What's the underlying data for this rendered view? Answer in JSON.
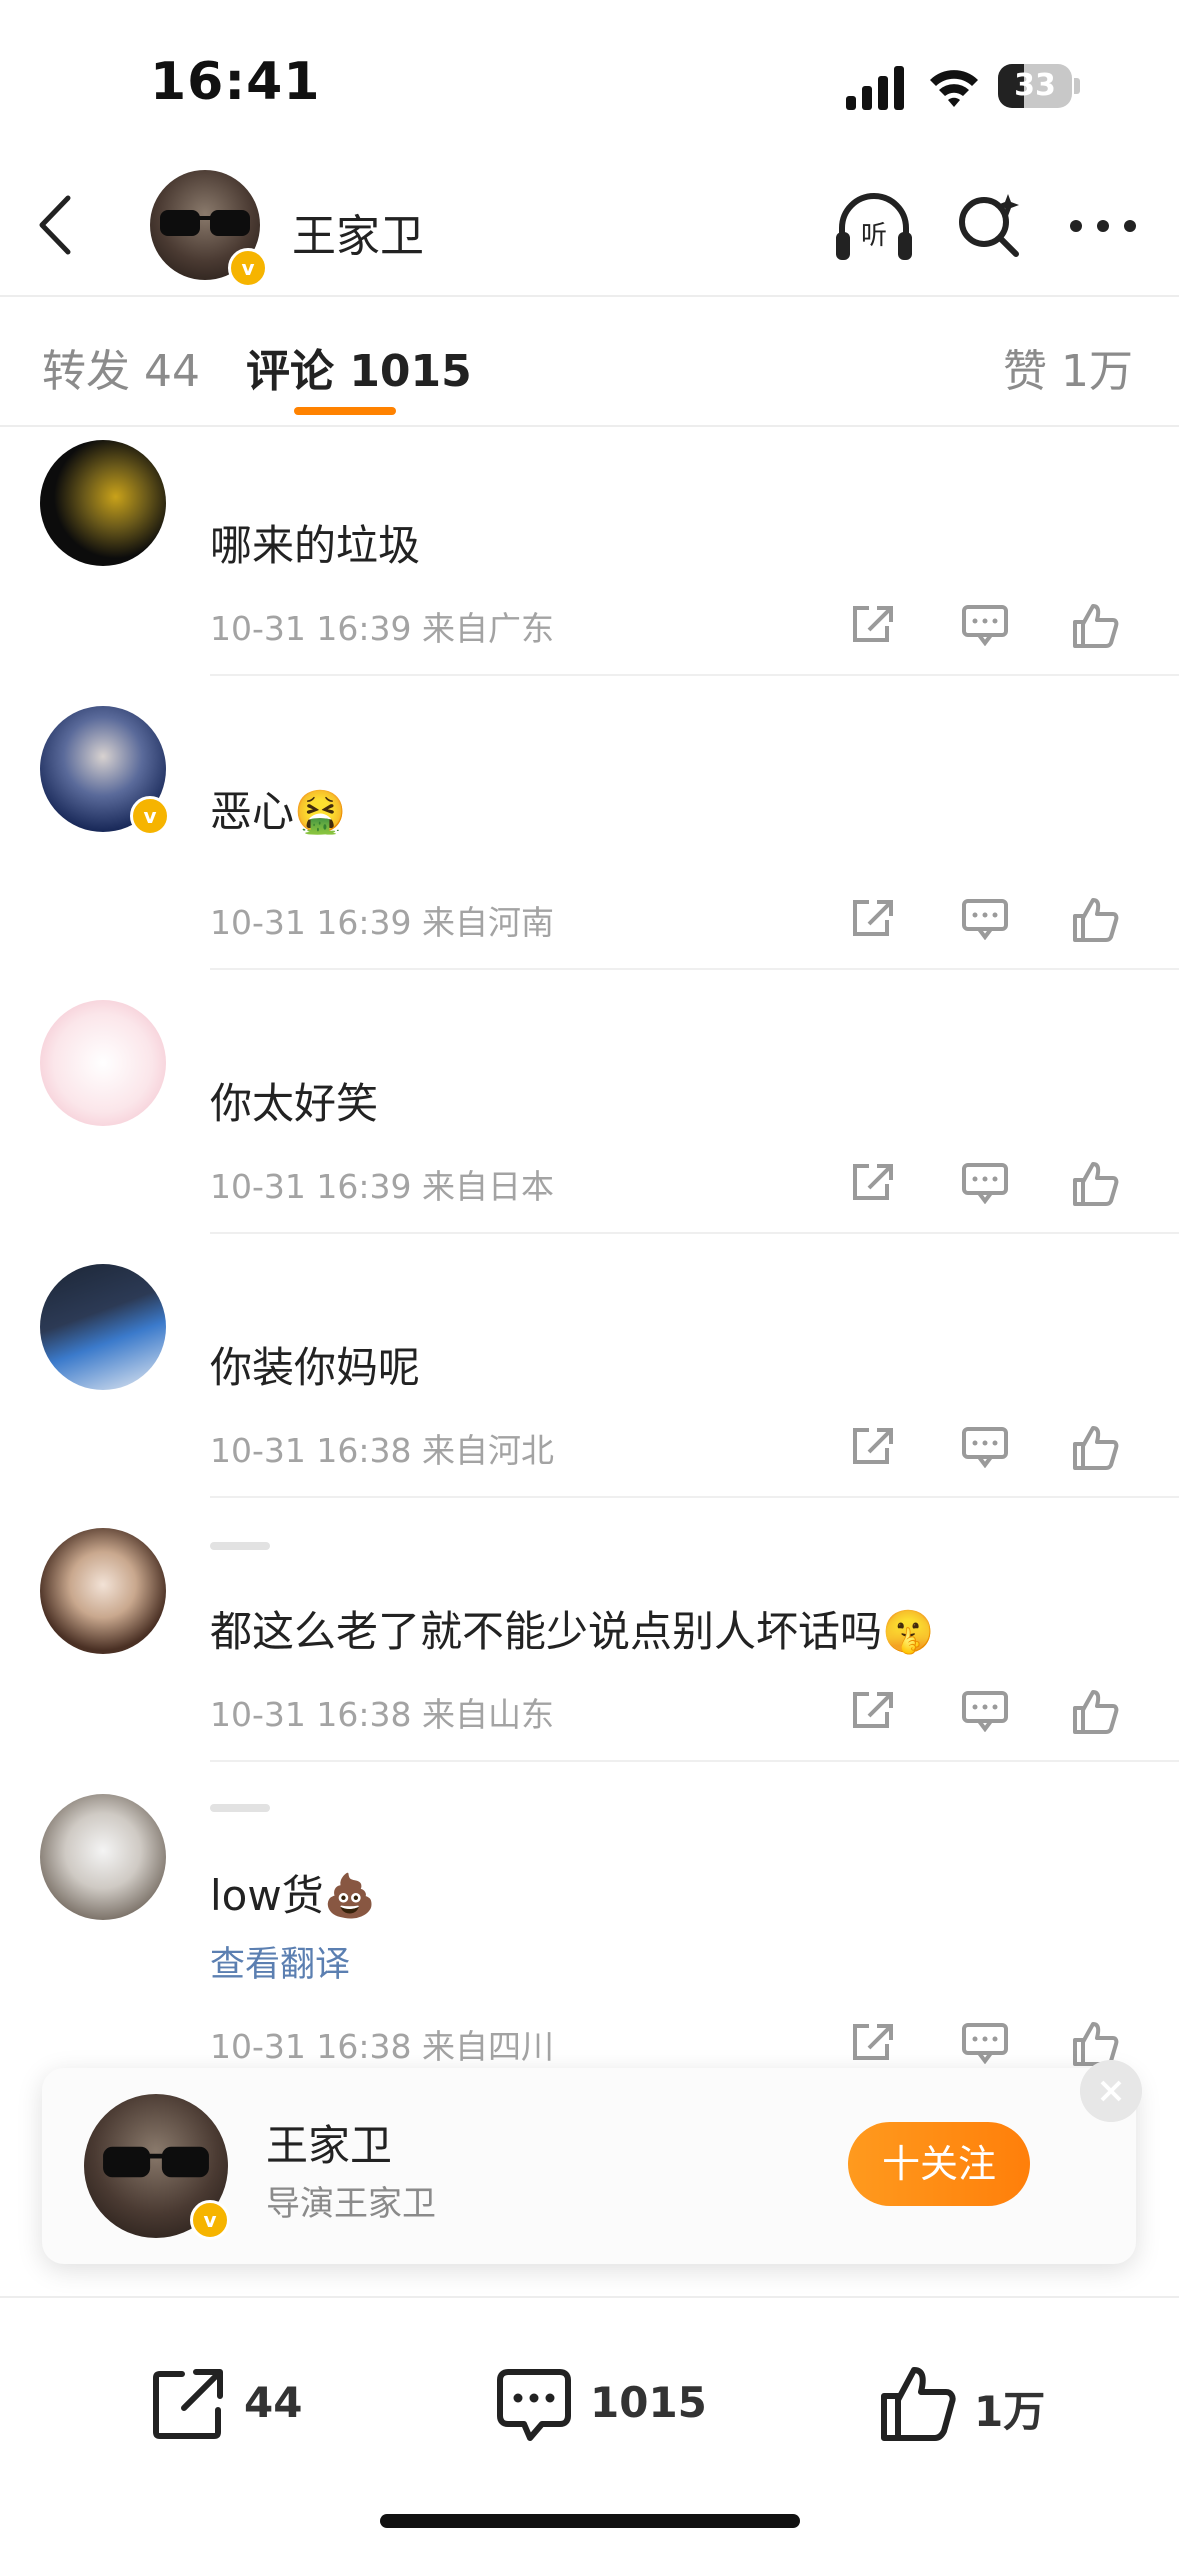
{
  "status_bar": {
    "time": "16:41",
    "battery": "33"
  },
  "header": {
    "name": "王家卫",
    "icons": [
      "back-icon",
      "listen-icon",
      "search-icon",
      "more-icon"
    ]
  },
  "tabs": {
    "repost": "转发 44",
    "comments": "评论 1015",
    "likes": "赞 1万"
  },
  "comments": [
    {
      "text": "哪来的垃圾",
      "time": "10-31 16:39",
      "location": "来自广东"
    },
    {
      "text": "恶心🤮",
      "time": "10-31 16:39",
      "location": "来自河南"
    },
    {
      "text": "你太好笑",
      "time": "10-31 16:39",
      "location": "来自日本"
    },
    {
      "text": "你装你妈呢",
      "time": "10-31 16:38",
      "location": "来自河北"
    },
    {
      "text": "都这么老了就不能少说点别人坏话吗🤫",
      "time": "10-31 16:38",
      "location": "来自山东"
    },
    {
      "text": "low货💩",
      "translate": "查看翻译",
      "time": "10-31 16:38",
      "location": "来自四川"
    }
  ],
  "follow_popup": {
    "name": "王家卫",
    "subtitle": "导演王家卫",
    "button": "十关注"
  },
  "bottom_bar": {
    "reposts": "44",
    "comments": "1015",
    "likes": "1万"
  },
  "colors": {
    "accent": "#ff8200",
    "verified": "#f6b400",
    "link": "#5b7fb1"
  }
}
